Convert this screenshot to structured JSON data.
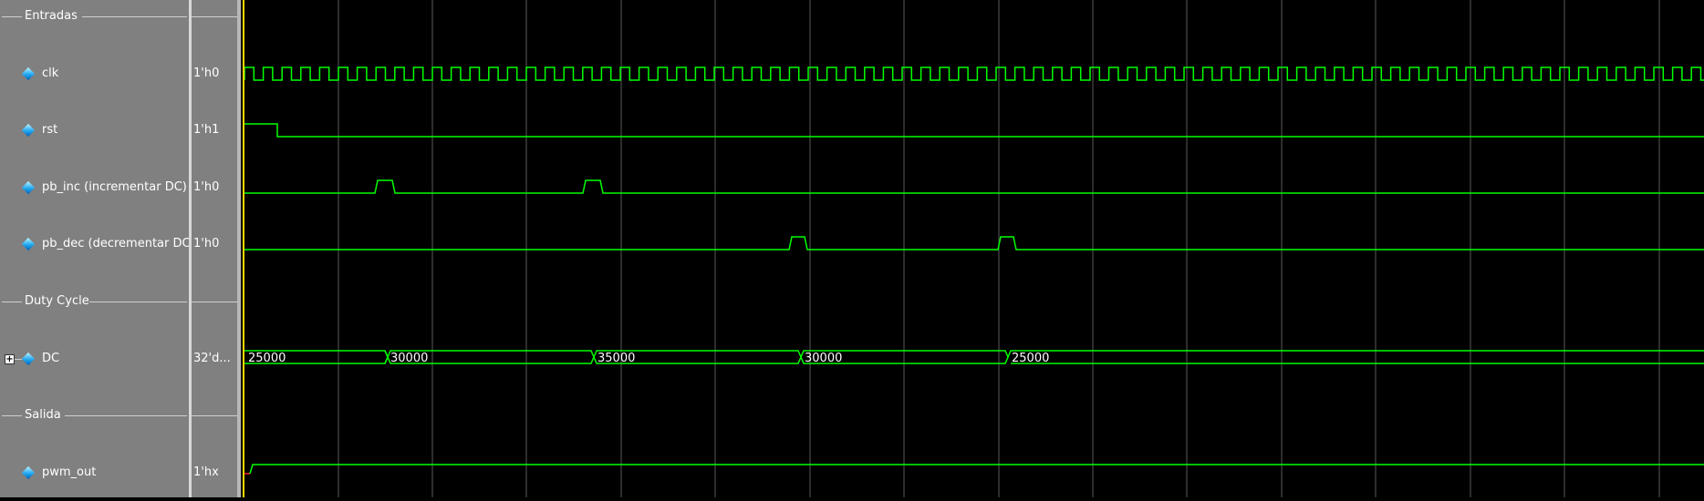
{
  "groups": [
    {
      "label": "Entradas"
    },
    {
      "label": "Duty Cycle"
    },
    {
      "label": "Salida"
    }
  ],
  "signals": [
    {
      "name": "clk",
      "value": "1'h0"
    },
    {
      "name": "rst",
      "value": "1'h1"
    },
    {
      "name": "pb_inc (incrementar DC)",
      "value": "1'h0"
    },
    {
      "name": "pb_dec (decrementar DC)",
      "value": "1'h0"
    },
    {
      "name": "DC",
      "value": "32'd..."
    },
    {
      "name": "pwm_out",
      "value": "1'hx"
    }
  ],
  "expander_symbol": "+",
  "dc_bus_values": [
    "25000",
    "30000",
    "35000",
    "30000",
    "25000"
  ],
  "colors": {
    "wave": "#00ff00",
    "cursor": "#ffd700",
    "grid": "#5a5a5a",
    "panel": "#808080",
    "background": "#000000"
  }
}
